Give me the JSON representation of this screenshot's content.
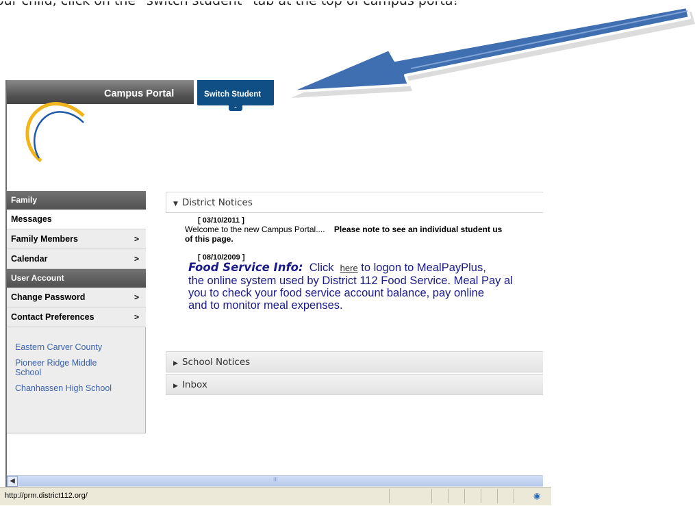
{
  "instruction": "our child, click on the “switch student” tab at the top of campus porta!",
  "header": {
    "brand": "Campus Portal",
    "switch_tab": "Switch Student"
  },
  "sidebar": {
    "family_heading": "Family",
    "items": [
      {
        "label": "Messages",
        "arrow": ""
      },
      {
        "label": "Family Members",
        "arrow": ">"
      },
      {
        "label": "Calendar",
        "arrow": ">"
      }
    ],
    "account_heading": "User Account",
    "account_items": [
      {
        "label": "Change Password",
        "arrow": ">"
      },
      {
        "label": "Contact Preferences",
        "arrow": ">"
      }
    ],
    "links": [
      "Eastern Carver County",
      "Pioneer Ridge Middle School",
      "Chanhassen High School"
    ]
  },
  "main": {
    "district_notices": "District Notices",
    "notice1": {
      "date": "[ 03/10/2011 ]",
      "text": "Welcome to the new Campus Portal....",
      "bold": "Please note to see an individual student us",
      "bold2": "of this page."
    },
    "notice2": {
      "date": "[ 08/10/2009 ]",
      "title": "Food Service Info:",
      "click": "Click",
      "here": "here",
      "line1_rest": "to logon to MealPayPlus,",
      "line2": "the online system used by District 112 Food Service.  Meal Pay al",
      "line3": "you to check your food service account balance, pay online",
      "line4": "and to monitor meal expenses."
    },
    "school_notices": "School Notices",
    "inbox": "Inbox"
  },
  "status": {
    "url": "http://prm.district112.org/",
    "scroll_mark": "III"
  },
  "colors": {
    "tab_blue": "#0f4f86",
    "arrow_blue": "#3f6fb0",
    "link_blue": "#3a63b0"
  }
}
